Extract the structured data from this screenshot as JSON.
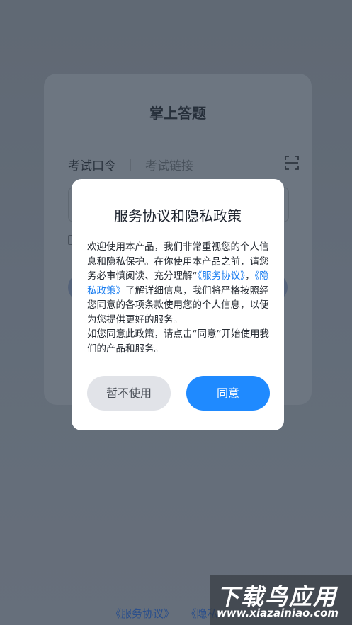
{
  "app": {
    "title": "掌上答题"
  },
  "tabs": [
    {
      "label": "考试口令"
    },
    {
      "label": "考试链接"
    }
  ],
  "dialog": {
    "title": "服务协议和隐私政策",
    "p1_a": "欢迎使用本产品，我们非常重视您的个人信息和隐私保护。在你使用本产品之前，请您务必审慎阅读、充分理解“",
    "link_service": "《服务协议》",
    "p1_b": "，",
    "link_privacy": "《隐私政策》",
    "p1_c": "了解详细信息，我们将严格按照经您同意的各项条款使用您的个人信息，以便为您提供更好的服务。",
    "p2": "如您同意此政策，请点击“同意”开始使用我们的产品和服务。",
    "cancel_label": "暂不使用",
    "agree_label": "同意"
  },
  "footer": {
    "link_service": "《服务协议》",
    "link_privacy_partial": "《隐私"
  },
  "watermark": {
    "title": "下载鸟应用",
    "url": "www.xiazainiao.com"
  },
  "colors": {
    "accent": "#1f8aff",
    "link": "#1a7df0",
    "cancel_bg": "#e1e3e8"
  }
}
